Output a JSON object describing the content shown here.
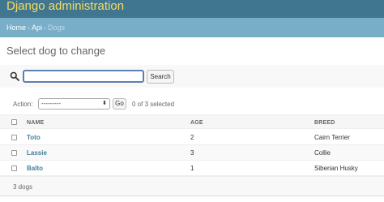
{
  "header": {
    "branding": "Django administration",
    "background_color": "#417690",
    "branding_color": "#f5dd5d"
  },
  "breadcrumbs": {
    "items": [
      "Home",
      "Api",
      "Dogs"
    ],
    "separator": "›",
    "background_color": "#79aec8"
  },
  "page_title": "Select dog to change",
  "search": {
    "value": "",
    "placeholder": "",
    "button_label": "Search",
    "icon": "search-icon"
  },
  "actions": {
    "label": "Action:",
    "selected": "---------",
    "go_label": "Go",
    "selection_counter": "0 of 3 selected"
  },
  "table": {
    "columns": [
      "NAME",
      "AGE",
      "BREED"
    ],
    "rows": [
      {
        "name": "Toto",
        "age": "2",
        "breed": "Cairn Terrier"
      },
      {
        "name": "Lassie",
        "age": "3",
        "breed": "Collie"
      },
      {
        "name": "Balto",
        "age": "1",
        "breed": "Siberian Husky"
      }
    ]
  },
  "paginator": {
    "text": "3 dogs"
  }
}
